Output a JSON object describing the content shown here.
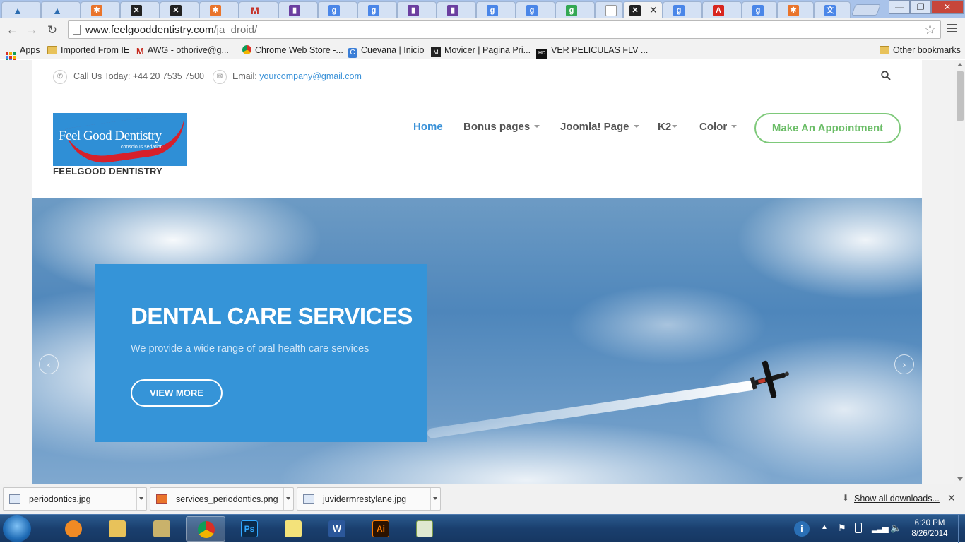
{
  "browser": {
    "url_host": "www.feelgooddentistry.com",
    "url_path": "/ja_droid/",
    "tabs": [
      {
        "icon": "triangle-icon",
        "active": false
      },
      {
        "icon": "triangle-icon",
        "active": false
      },
      {
        "icon": "joomla-icon",
        "active": false
      },
      {
        "icon": "xbox-icon",
        "active": false
      },
      {
        "icon": "xbox-icon",
        "active": false
      },
      {
        "icon": "joomla-icon",
        "active": false
      },
      {
        "icon": "gmail-icon",
        "active": false
      },
      {
        "icon": "purple-square-icon",
        "active": false
      },
      {
        "icon": "google-icon",
        "active": false
      },
      {
        "icon": "google-icon",
        "active": false
      },
      {
        "icon": "purple-square-icon",
        "active": false
      },
      {
        "icon": "purple-square-icon",
        "active": false
      },
      {
        "icon": "google-icon",
        "active": false
      },
      {
        "icon": "google-icon",
        "active": false
      },
      {
        "icon": "google-plus-icon",
        "active": false
      },
      {
        "icon": "page-icon",
        "active": false
      },
      {
        "icon": "xbox-icon",
        "active": true
      },
      {
        "icon": "google-icon",
        "active": false
      },
      {
        "icon": "adobe-icon",
        "active": false
      },
      {
        "icon": "google-icon",
        "active": false
      },
      {
        "icon": "joomla-icon",
        "active": false
      },
      {
        "icon": "translate-icon",
        "active": false
      }
    ],
    "bookmarks": [
      {
        "label": "Apps"
      },
      {
        "label": "Imported From IE"
      },
      {
        "label": "AWG - othorive@g..."
      },
      {
        "label": "Chrome Web Store -..."
      },
      {
        "label": "Cuevana | Inicio"
      },
      {
        "label": "Movicer | Pagina Pri..."
      },
      {
        "label": "VER PELICULAS FLV ..."
      },
      {
        "label": "Other bookmarks"
      }
    ]
  },
  "site": {
    "phone": "Call Us Today: +44 20 7535 7500",
    "email_label": "Email: ",
    "email": "yourcompany@gmail.com",
    "logo_text": "Feel Good Dentistry",
    "logo_sub": "conscious sedation",
    "site_name": "FEELGOOD DENTISTRY",
    "nav": [
      "Home",
      "Bonus pages",
      "Joomla! Page",
      "K2",
      "Color"
    ],
    "cta": "Make An Appointment",
    "hero": {
      "title": "DENTAL CARE SERVICES",
      "subtitle": "We provide a wide range of oral health care services",
      "button": "VIEW MORE"
    }
  },
  "downloads": {
    "items": [
      "periodontics.jpg",
      "services_periodontics.png",
      "juvidermrestylane.jpg"
    ],
    "show_all": "Show all downloads..."
  },
  "taskbar": {
    "time": "6:20 PM",
    "date": "8/26/2014"
  },
  "colors": {
    "accent_blue": "#3594d8",
    "cta_green": "#6bbd67"
  }
}
